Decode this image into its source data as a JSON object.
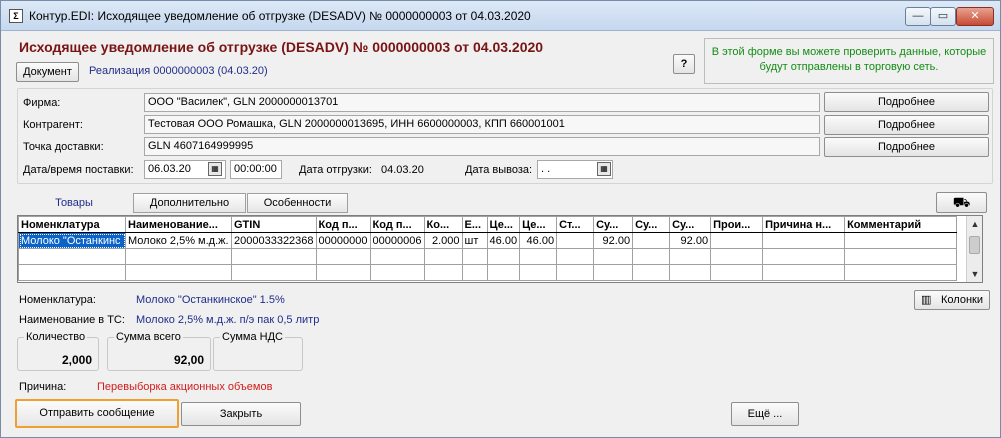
{
  "window": {
    "title": "Контур.EDI: Исходящее уведомление об отгрузке (DESADV) № 0000000003 от 04.03.2020",
    "app_icon_glyph": "Σ",
    "minimize_glyph": "—",
    "maximize_glyph": "▭",
    "close_glyph": "✕"
  },
  "header": {
    "title": "Исходящее уведомление об отгрузке (DESADV) № 0000000003 от 04.03.2020",
    "document_button": "Документ",
    "realization_link": "Реализация  0000000003 (04.03.20)",
    "help_label": "?",
    "info_text": "В этой форме вы можете проверить данные, которые будут отправлены в торговую сеть."
  },
  "fields": {
    "firm_label": "Фирма:",
    "firm_value": "ООО \"Василек\", GLN 2000000013701",
    "counterparty_label": "Контрагент:",
    "counterparty_value": "Тестовая ООО Ромашка, GLN 2000000013695, ИНН 6600000003, КПП 660001001",
    "delivery_point_label": "Точка доставки:",
    "delivery_point_value": "GLN 4607164999995",
    "details_label": "Подробнее",
    "delivery_dt_label": "Дата/время поставки:",
    "delivery_date": "06.03.20",
    "delivery_time": "00:00:00",
    "shipment_date_label": "Дата отгрузки:",
    "shipment_date": "04.03.20",
    "export_date_label": "Дата вывоза:",
    "export_date": " .  ."
  },
  "tabs": [
    "Товары",
    "Дополнительно",
    "Особенности"
  ],
  "grid": {
    "columns": [
      "Номенклатура",
      "Наименование...",
      "GTIN",
      "Код п...",
      "Код п...",
      "Ко...",
      "Е...",
      "Це...",
      "Це...",
      "Ст...",
      "Су...",
      "Су...",
      "Су...",
      "Прои...",
      "Причина н...",
      "Комментарий"
    ],
    "rows": [
      [
        "Молоко \"Останкинс",
        "Молоко 2,5% м.д.ж.",
        "2000033322368",
        "00000000",
        "00000006",
        "2.000",
        "шт",
        "46.00",
        "46.00",
        "",
        "92.00",
        "",
        "92.00",
        "",
        "",
        ""
      ],
      [
        "",
        "",
        "",
        "",
        "",
        "",
        "",
        "",
        "",
        "",
        "",
        "",
        "",
        "",
        "",
        ""
      ],
      [
        "",
        "",
        "",
        "",
        "",
        "",
        "",
        "",
        "",
        "",
        "",
        "",
        "",
        "",
        "",
        ""
      ]
    ]
  },
  "details": {
    "nomenclature_label": "Номенклатура:",
    "nomenclature_value": "Молоко \"Останкинское\" 1.5%",
    "ts_name_label": "Наименование в ТС:",
    "ts_name_value": "Молоко 2,5% м.д.ж. п/э пак 0,5 литр",
    "columns_button": "Колонки"
  },
  "totals": {
    "qty_label": "Количество",
    "qty_value": "2,000",
    "sum_label": "Сумма всего",
    "sum_value": "92,00",
    "vat_label": "Сумма НДС",
    "vat_value": ""
  },
  "reason": {
    "label": "Причина:",
    "value": "Перевыборка акционных объемов"
  },
  "footer": {
    "send": "Отправить сообщение",
    "close": "Закрыть",
    "more": "Ещё ..."
  }
}
